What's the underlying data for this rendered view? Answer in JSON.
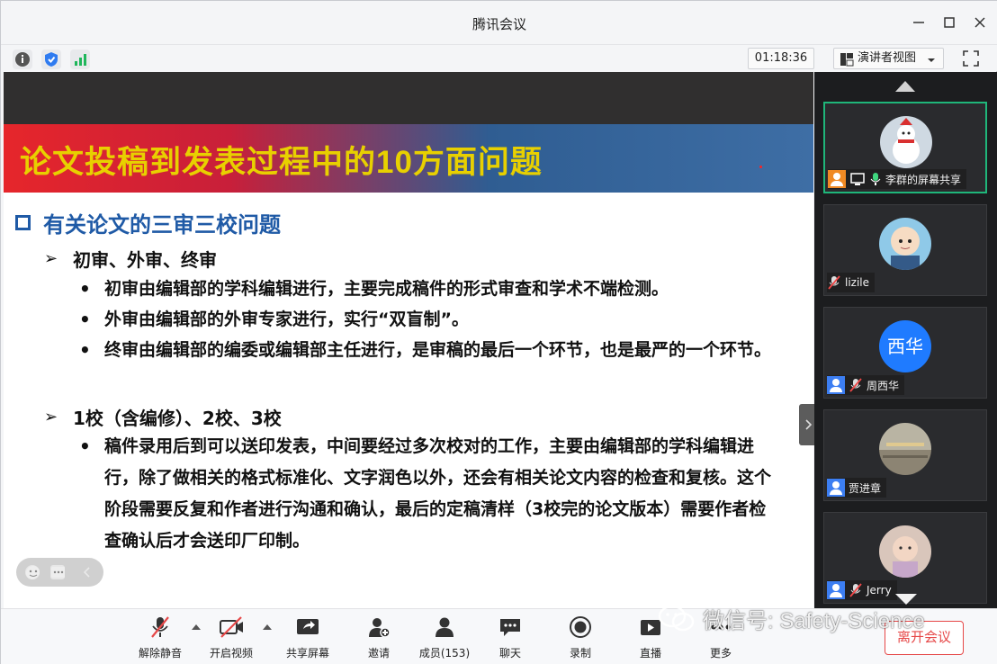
{
  "window": {
    "title": "腾讯会议",
    "minimize": "—",
    "maximize": "☐",
    "close": "✕"
  },
  "toolbar": {
    "timer": "01:18:36",
    "view_mode": "演讲者视图"
  },
  "slide": {
    "title": "论文投稿到发表过程中的10方面问题",
    "section": "有关论文的三审三校问题",
    "sub1": "初审、外审、终审",
    "bullets1": [
      "初审由编辑部的学科编辑进行，主要完成稿件的形式审查和学术不端检测。",
      "外审由编辑部的外审专家进行，实行“双盲制”。",
      "终审由编辑部的编委或编辑部主任进行，是审稿的最后一个环节，也是最严的一个环节。"
    ],
    "sub2": "1校（含编修）、2校、3校",
    "bullets2": [
      "稿件录用后到可以送印发表，中间要经过多次校对的工作，主要由编辑部的学科编辑进行，除了做相关的格式标准化、文字润色以外，还会有相关论文内容的检查和复核。这个阶段需要反复和作者进行沟通和确认，最后的定稿清样（3校完的论文版本）需要作者检查确认后才会送印厂印制。"
    ]
  },
  "participants": [
    {
      "name": "李群的屏幕共享",
      "avatar": "snowman-avatar",
      "active": true
    },
    {
      "name": "lizile",
      "avatar": "cartoon-avatar",
      "active": false
    },
    {
      "name": "周西华",
      "avatar_text": "西华",
      "active": false
    },
    {
      "name": "贾进章",
      "avatar": "landscape-avatar",
      "active": false
    },
    {
      "name": "Jerry",
      "avatar": "child-avatar",
      "active": false
    }
  ],
  "controls": {
    "mute": "解除静音",
    "video": "开启视频",
    "share": "共享屏幕",
    "invite": "邀请",
    "members": "成员(153)",
    "chat": "聊天",
    "record": "录制",
    "live": "直播",
    "more": "更多",
    "leave": "离开会议"
  },
  "watermark": "微信号: Safety-Science",
  "colors": {
    "accent_blue": "#1f5aa6",
    "title_yellow": "#e8d000",
    "active_border": "#1fb67a",
    "leave_red": "#e64848"
  }
}
